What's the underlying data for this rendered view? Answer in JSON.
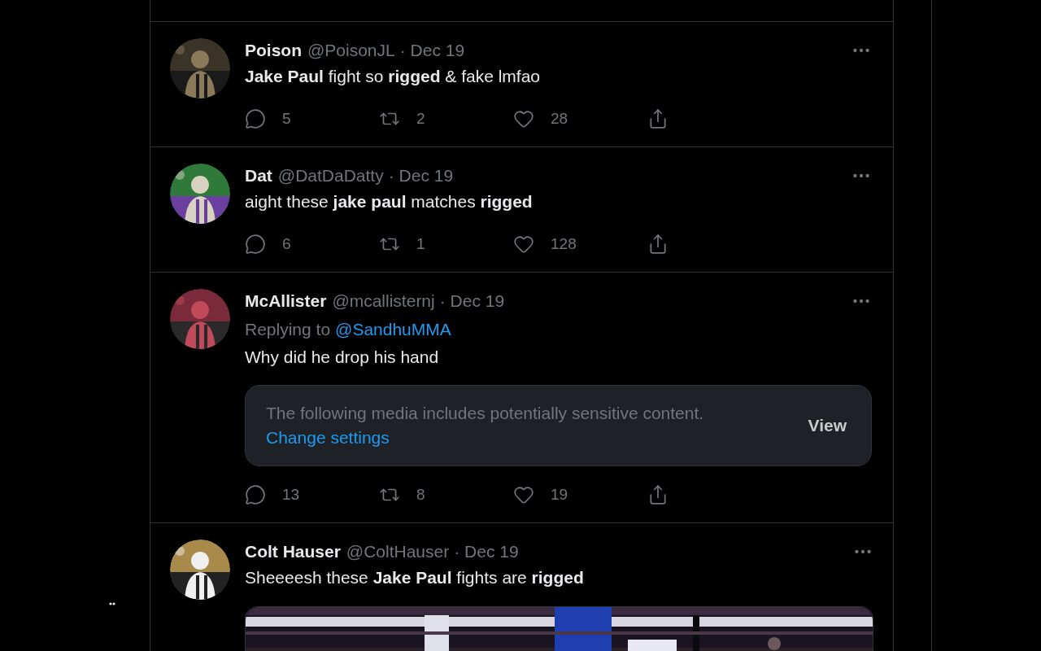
{
  "tweets": [
    {
      "name": "Poison",
      "handle": "@PoisonJL",
      "date": "· Dec 19",
      "text": "**Jake Paul** fight so **rigged** & fake lmfao",
      "replies": "5",
      "retweets": "2",
      "likes": "28"
    },
    {
      "name": "Dat",
      "handle": "@DatDaDatty",
      "date": "· Dec 19",
      "text": "aight these **jake paul** matches **rigged**",
      "replies": "6",
      "retweets": "1",
      "likes": "128"
    },
    {
      "name": "McAllister",
      "handle": "@mcallisternj",
      "date": "· Dec 19",
      "reply_label": "Replying to",
      "reply_to": "@SandhuMMA",
      "text": "Why did he drop his hand",
      "media": {
        "kind": "sensitive",
        "notice": "The following media includes potentially sensitive content.",
        "link": "Change settings",
        "button": "View"
      },
      "replies": "13",
      "retweets": "8",
      "likes": "19"
    },
    {
      "name": "Colt Hauser",
      "handle": "@ColtHauser",
      "date": "· Dec 19",
      "text": "Sheeeesh these **Jake Paul** fights are **rigged**"
    }
  ]
}
